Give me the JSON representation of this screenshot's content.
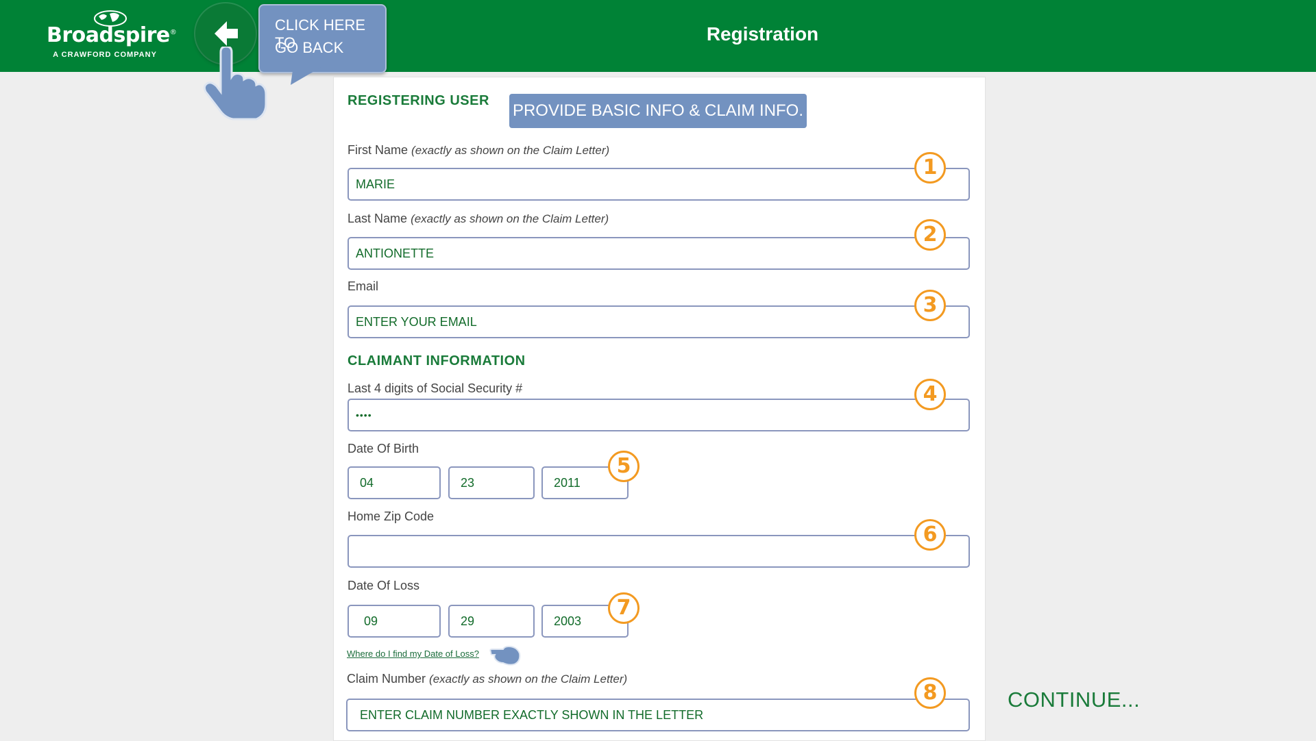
{
  "header": {
    "logo_brand": "Broadspire",
    "logo_reg": "®",
    "logo_sub": "A CRAWFORD COMPANY",
    "page_title": "Registration",
    "bg_color": "#008236"
  },
  "back_tooltip": {
    "line1": "CLICK HERE TO",
    "line2": "GO BACK"
  },
  "banner": "PROVIDE BASIC INFO & CLAIM INFO.",
  "sections": {
    "registering_user": "REGISTERING USER",
    "claimant_info": "CLAIMANT INFORMATION"
  },
  "fields": {
    "first_name": {
      "label": "First Name",
      "hint": "(exactly as shown on the Claim Letter)",
      "value": "MARIE",
      "badge": "1"
    },
    "last_name": {
      "label": "Last Name",
      "hint": "(exactly as shown on the Claim Letter)",
      "value": "ANTIONETTE",
      "badge": "2"
    },
    "email": {
      "label": "Email",
      "value": "ENTER YOUR EMAIL",
      "badge": "3"
    },
    "ssn": {
      "label": "Last 4 digits of Social Security #",
      "value": "••••",
      "badge": "4"
    },
    "dob": {
      "label": "Date Of Birth",
      "month": "04",
      "day": "23",
      "year": "2011",
      "badge": "5"
    },
    "zip": {
      "label": "Home Zip Code",
      "value": "",
      "badge": "6"
    },
    "dol": {
      "label": "Date Of Loss",
      "month": "09",
      "day": "29",
      "year": "2003",
      "badge": "7"
    },
    "claim_number": {
      "label": "Claim Number",
      "hint": "(exactly as shown on the Claim Letter)",
      "value": "ENTER CLAIM NUMBER EXACTLY SHOWN IN THE LETTER",
      "badge": "8"
    }
  },
  "help_link": "Where do I find my Date of Loss?",
  "continue_text": "CONTINUE...",
  "colors": {
    "accent_orange": "#f39a21",
    "callout_blue": "#7392c0",
    "green_text": "#1a7b3a"
  }
}
